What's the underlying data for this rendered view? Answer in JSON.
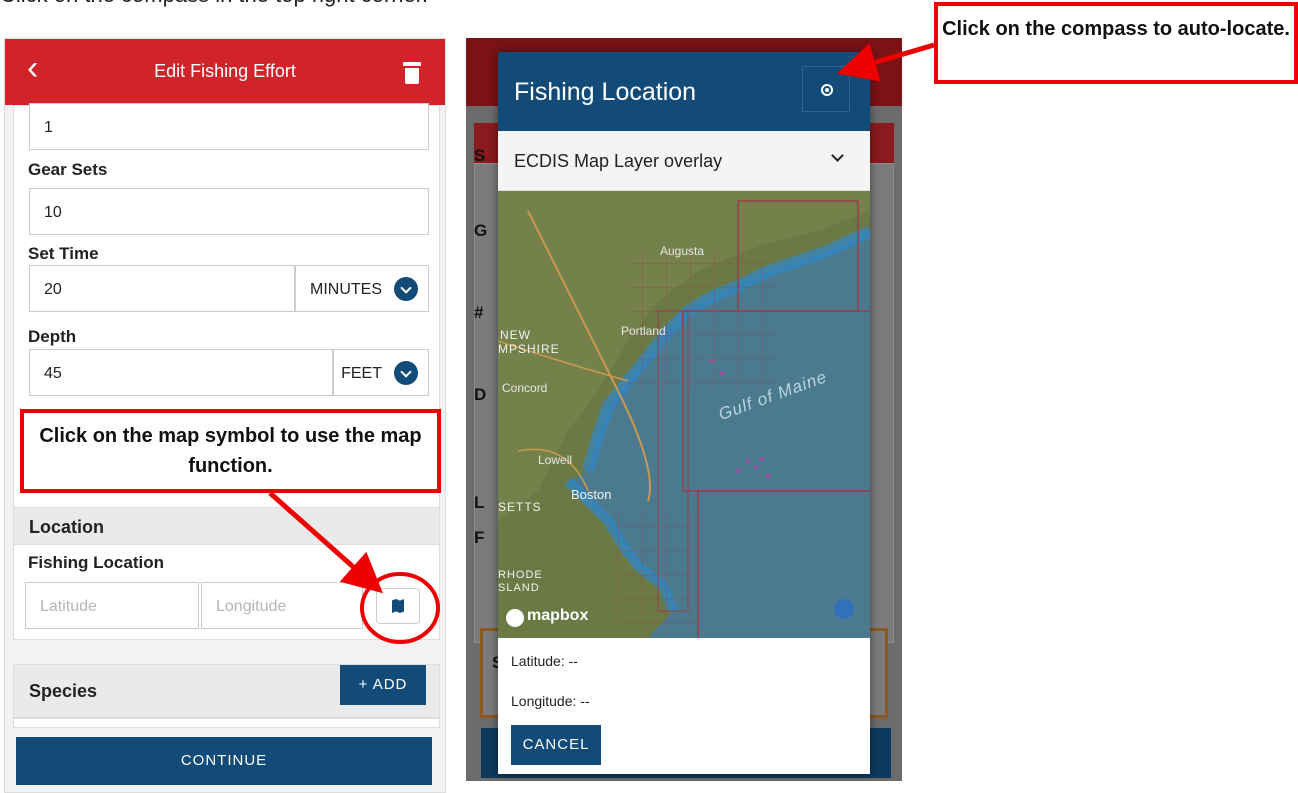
{
  "instruction": "Click on the compass in the top right corner.",
  "left_screen": {
    "header_title": "Edit Fishing Effort",
    "first_value": "1",
    "gear_sets_label": "Gear Sets",
    "gear_sets_value": "10",
    "set_time_label": "Set Time",
    "set_time_value": "20",
    "set_time_unit": "MINUTES",
    "depth_label": "Depth",
    "depth_value": "45",
    "depth_unit": "FEET",
    "location_section": "Location",
    "fishing_location_label": "Fishing Location",
    "latitude_placeholder": "Latitude",
    "longitude_placeholder": "Longitude",
    "species_section": "Species",
    "add_button": "+ ADD",
    "continue_button": "CONTINUE"
  },
  "modal": {
    "title": "Fishing Location",
    "layer_select": "ECDIS Map Layer overlay",
    "latitude": "Latitude: --",
    "longitude": "Longitude: --",
    "cancel_button": "CANCEL"
  },
  "map": {
    "labels": [
      "Augusta",
      "Portland",
      "NEW",
      "MPSHIRE",
      "Concord",
      "Gulf of Maine",
      "Lowell",
      "Boston",
      "SETTS",
      "RHODE",
      "SLAND"
    ],
    "attribution": "mapbox"
  },
  "background_letters": [
    "S",
    "G",
    "#",
    "D",
    "L",
    "F",
    "S"
  ],
  "callouts": {
    "map_symbol": "Click on the map symbol to use the map function.",
    "compass": "Click on the compass to auto-locate."
  },
  "colors": {
    "header_red": "#d0232a",
    "primary_blue": "#124b78",
    "annotation_red": "#ee0000"
  }
}
